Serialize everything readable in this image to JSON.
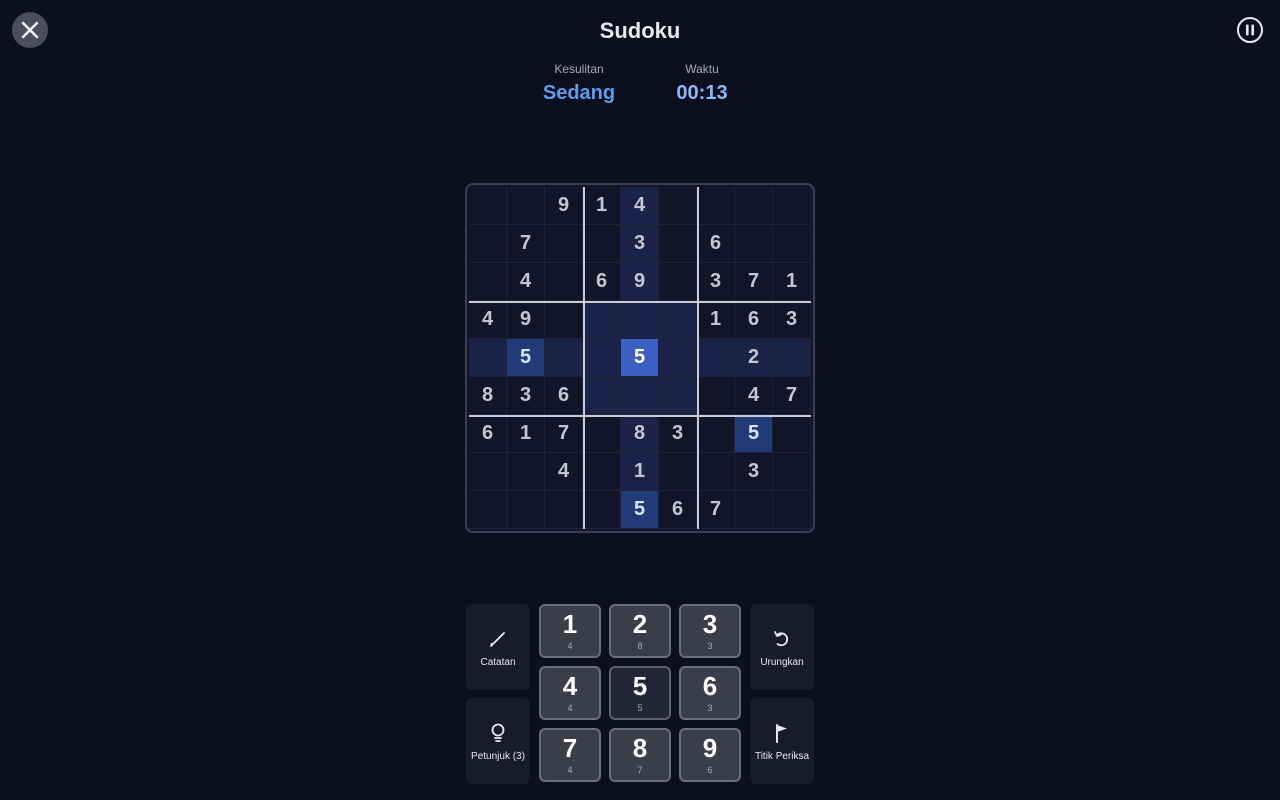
{
  "header": {
    "title": "Sudoku",
    "difficulty_label": "Kesulitan",
    "difficulty_value": "Sedang",
    "time_label": "Waktu",
    "time_value": "00:13"
  },
  "board": {
    "rows": [
      [
        "",
        "",
        "9",
        "1",
        "4",
        "",
        "",
        "",
        ""
      ],
      [
        "",
        "7",
        "",
        "",
        "3",
        "",
        "6",
        "",
        ""
      ],
      [
        "",
        "4",
        "",
        "6",
        "9",
        "",
        "3",
        "7",
        "1"
      ],
      [
        "4",
        "9",
        "",
        "",
        "",
        "",
        "1",
        "6",
        "3"
      ],
      [
        "",
        "5",
        "",
        "",
        "5",
        "",
        "",
        "2",
        ""
      ],
      [
        "8",
        "3",
        "6",
        "",
        "",
        "",
        "",
        "4",
        "7"
      ],
      [
        "6",
        "1",
        "7",
        "",
        "8",
        "3",
        "",
        "5",
        ""
      ],
      [
        "",
        "",
        "4",
        "",
        "1",
        "",
        "",
        "3",
        ""
      ],
      [
        "",
        "",
        "",
        "",
        "5",
        "6",
        "7",
        "",
        ""
      ]
    ],
    "selected": [
      4,
      4
    ]
  },
  "tools": {
    "notes": "Catatan",
    "undo": "Urungkan",
    "hint": "Petunjuk (3)",
    "checkpoint": "Titik Periksa"
  },
  "keypad": [
    {
      "num": "1",
      "count": "4"
    },
    {
      "num": "2",
      "count": "8"
    },
    {
      "num": "3",
      "count": "3"
    },
    {
      "num": "4",
      "count": "4"
    },
    {
      "num": "5",
      "count": "5"
    },
    {
      "num": "6",
      "count": "3"
    },
    {
      "num": "7",
      "count": "4"
    },
    {
      "num": "8",
      "count": "7"
    },
    {
      "num": "9",
      "count": "6"
    }
  ],
  "colors": {
    "background": "#0d0f1f",
    "accent": "#5b9cf0",
    "selected_cell": "#3a5fc0",
    "same_number_cell": "#223a78",
    "highlight_cell": "#1a2347"
  }
}
